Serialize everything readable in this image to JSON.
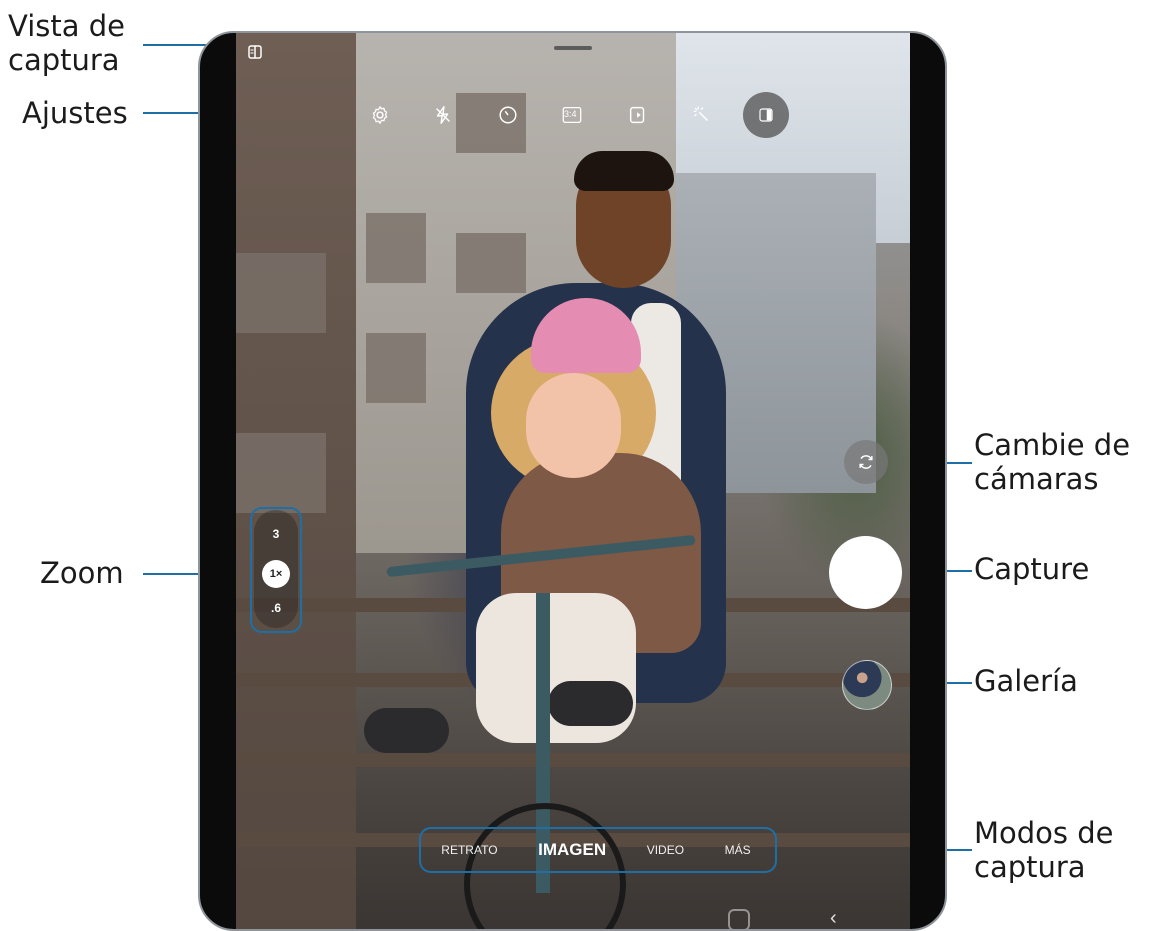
{
  "annotations": {
    "vista_de_captura": [
      "Vista de",
      "captura"
    ],
    "ajustes": "Ajustes",
    "zoom": "Zoom",
    "cambie_de_camaras": [
      "Cambie de",
      "cámaras"
    ],
    "capture": "Capture",
    "galeria": "Galería",
    "modos_de_captura": [
      "Modos de",
      "captura"
    ]
  },
  "top_bar": {
    "icons": [
      "settings-icon",
      "flash-off-icon",
      "timer-icon",
      "aspect-ratio-icon",
      "motion-photo-icon",
      "filter-icon",
      "capture-view-icon"
    ],
    "aspect_ratio_label": "3:4"
  },
  "zoom": {
    "options": [
      "3",
      "1×",
      ".6"
    ],
    "selected": "1×"
  },
  "modes": {
    "items": [
      "RETRATO",
      "IMAGEN",
      "VIDEO",
      "MÁS"
    ],
    "selected": "IMAGEN"
  },
  "colors": {
    "annotation_line": "#1f6fa6",
    "shutter": "#ffffff"
  }
}
